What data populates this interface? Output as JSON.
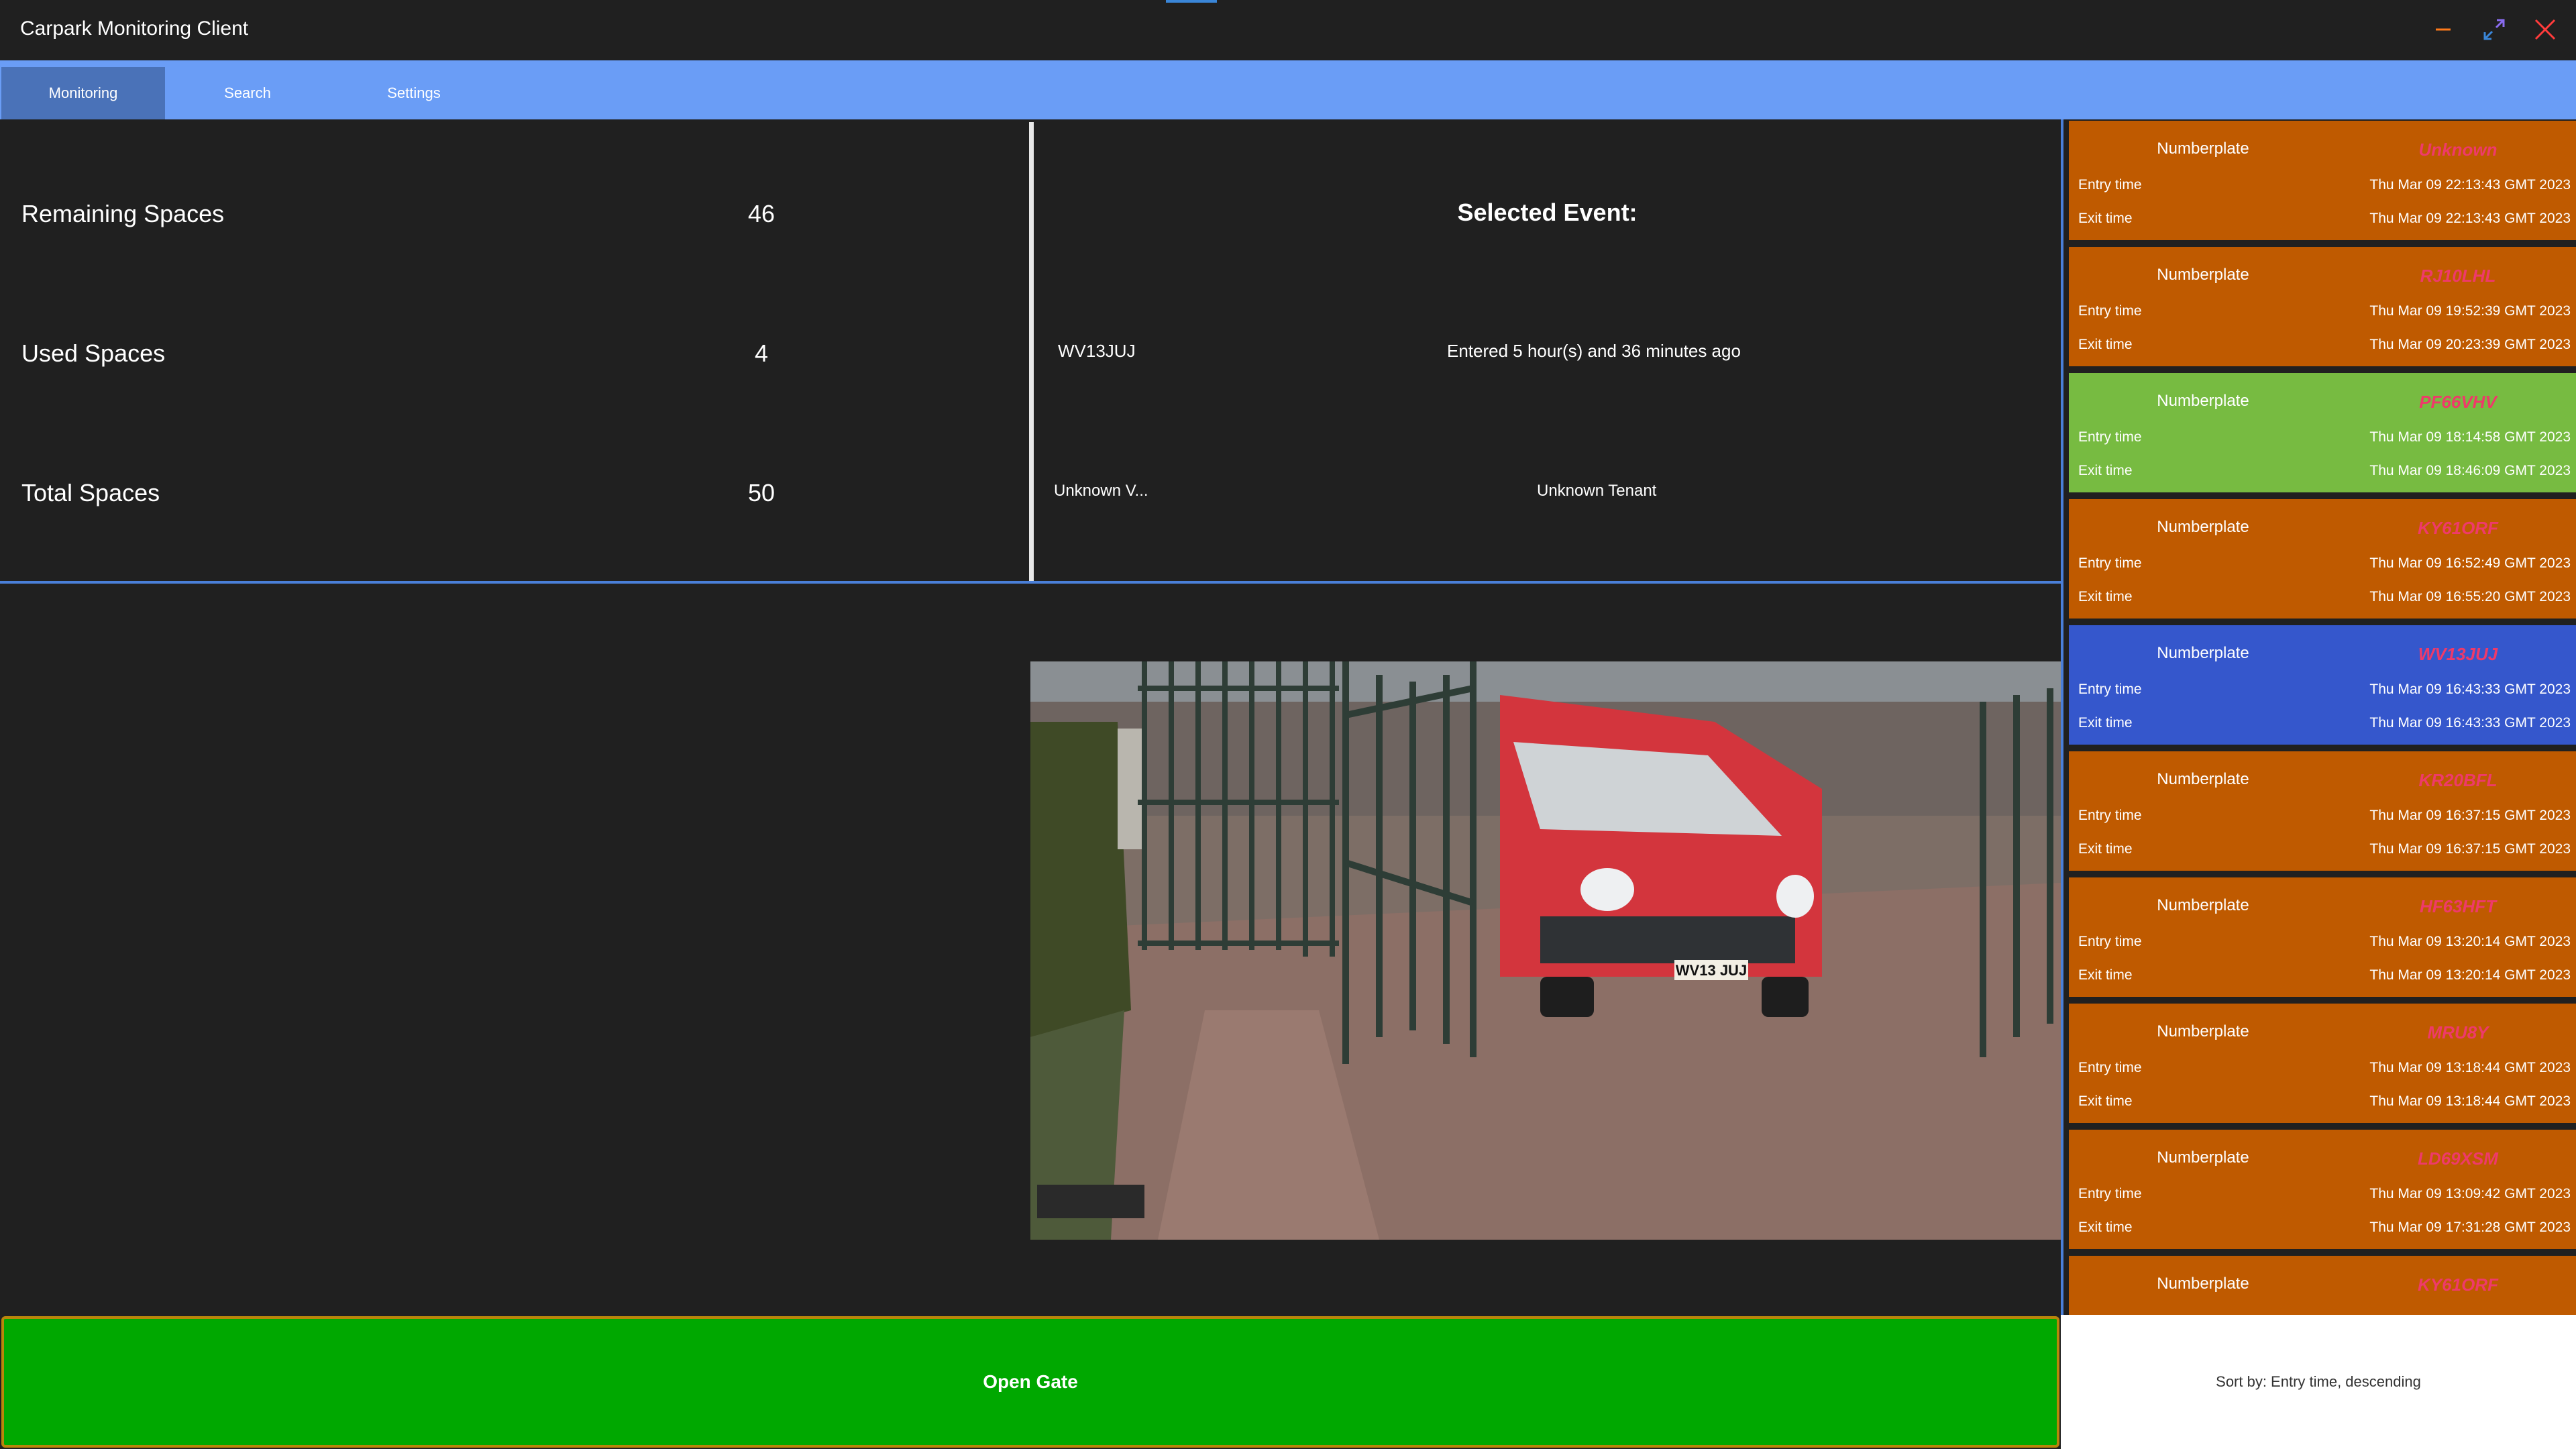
{
  "window": {
    "title": "Carpark Monitoring Client",
    "controls": {
      "minimize": "minimize-icon",
      "maximize": "maximize-icon",
      "close": "close-icon"
    }
  },
  "tabs": [
    {
      "label": "Monitoring",
      "active": true
    },
    {
      "label": "Search",
      "active": false
    },
    {
      "label": "Settings",
      "active": false
    }
  ],
  "stats": {
    "remaining": {
      "label": "Remaining Spaces",
      "value": "46"
    },
    "used": {
      "label": "Used Spaces",
      "value": "4"
    },
    "total": {
      "label": "Total Spaces",
      "value": "50"
    }
  },
  "selected_event": {
    "heading": "Selected Event:",
    "numberplate": "WV13JUJ",
    "entered": "Entered 5 hour(s) and 36 minutes ago",
    "vehicle": "Unknown V...",
    "tenant": "Unknown Tenant"
  },
  "camera": {
    "plate_text": "WV13 JUJ"
  },
  "open_gate_label": "Open Gate",
  "sort_label": "Sort by: Entry time, descending",
  "colors": {
    "orange": "#bf5a00",
    "green": "#77bb41",
    "blue": "#3557cc",
    "plate_text": "#ee3a6a",
    "tabbar": "#6a9df6",
    "open_gate": "#00a800"
  },
  "events": [
    {
      "color": "#bf5a00",
      "numberplate_label": "Numberplate",
      "plate": "Unknown",
      "entry_label": "Entry time",
      "entry": "Thu Mar 09 22:13:43 GMT 2023",
      "exit_label": "Exit time",
      "exit": "Thu Mar 09 22:13:43 GMT 2023"
    },
    {
      "color": "#bf5a00",
      "numberplate_label": "Numberplate",
      "plate": "RJ10LHL",
      "entry_label": "Entry time",
      "entry": "Thu Mar 09 19:52:39 GMT 2023",
      "exit_label": "Exit time",
      "exit": "Thu Mar 09 20:23:39 GMT 2023"
    },
    {
      "color": "#77bb41",
      "numberplate_label": "Numberplate",
      "plate": "PF66VHV",
      "entry_label": "Entry time",
      "entry": "Thu Mar 09 18:14:58 GMT 2023",
      "exit_label": "Exit time",
      "exit": "Thu Mar 09 18:46:09 GMT 2023"
    },
    {
      "color": "#bf5a00",
      "numberplate_label": "Numberplate",
      "plate": "KY61ORF",
      "entry_label": "Entry time",
      "entry": "Thu Mar 09 16:52:49 GMT 2023",
      "exit_label": "Exit time",
      "exit": "Thu Mar 09 16:55:20 GMT 2023"
    },
    {
      "color": "#3557cc",
      "numberplate_label": "Numberplate",
      "plate": "WV13JUJ",
      "entry_label": "Entry time",
      "entry": "Thu Mar 09 16:43:33 GMT 2023",
      "exit_label": "Exit time",
      "exit": "Thu Mar 09 16:43:33 GMT 2023"
    },
    {
      "color": "#bf5a00",
      "numberplate_label": "Numberplate",
      "plate": "KR20BFL",
      "entry_label": "Entry time",
      "entry": "Thu Mar 09 16:37:15 GMT 2023",
      "exit_label": "Exit time",
      "exit": "Thu Mar 09 16:37:15 GMT 2023"
    },
    {
      "color": "#bf5a00",
      "numberplate_label": "Numberplate",
      "plate": "HF63HFT",
      "entry_label": "Entry time",
      "entry": "Thu Mar 09 13:20:14 GMT 2023",
      "exit_label": "Exit time",
      "exit": "Thu Mar 09 13:20:14 GMT 2023"
    },
    {
      "color": "#bf5a00",
      "numberplate_label": "Numberplate",
      "plate": "MRU8Y",
      "entry_label": "Entry time",
      "entry": "Thu Mar 09 13:18:44 GMT 2023",
      "exit_label": "Exit time",
      "exit": "Thu Mar 09 13:18:44 GMT 2023"
    },
    {
      "color": "#bf5a00",
      "numberplate_label": "Numberplate",
      "plate": "LD69XSM",
      "entry_label": "Entry time",
      "entry": "Thu Mar 09 13:09:42 GMT 2023",
      "exit_label": "Exit time",
      "exit": "Thu Mar 09 17:31:28 GMT 2023"
    },
    {
      "color": "#bf5a00",
      "numberplate_label": "Numberplate",
      "plate": "KY61ORF",
      "entry_label": "",
      "entry": "",
      "exit_label": "",
      "exit": ""
    }
  ]
}
